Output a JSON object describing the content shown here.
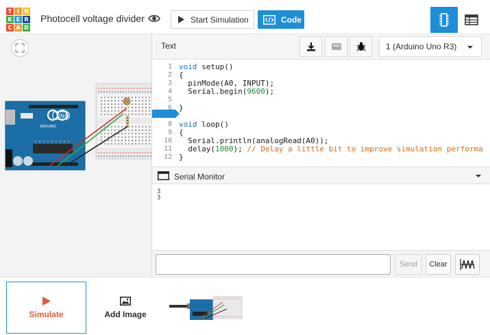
{
  "header": {
    "logo_letters": [
      "T",
      "I",
      "N",
      "K",
      "E",
      "R",
      "C",
      "A",
      "D"
    ],
    "logo_colors": [
      "#e84f3c",
      "#f29b2f",
      "#f6c31e",
      "#43b14b",
      "#2f9fd9",
      "#1a4e9a",
      "#e84f3c",
      "#f29b2f",
      "#43b14b"
    ],
    "project_title": "Photocell voltage divider",
    "start_simulation_label": "Start Simulation",
    "code_label": "Code"
  },
  "code_panel": {
    "mode": "Text",
    "device": "1 (Arduino Uno R3)",
    "lines": [
      {
        "n": "1",
        "text": "void setup()"
      },
      {
        "n": "2",
        "text": "{"
      },
      {
        "n": "3",
        "text": "  pinMode(A0, INPUT);"
      },
      {
        "n": "4",
        "text": "  Serial.begin(9600);"
      },
      {
        "n": "5",
        "text": ""
      },
      {
        "n": "6",
        "text": "}"
      },
      {
        "n": "7",
        "text": ""
      },
      {
        "n": "8",
        "text": "void loop()"
      },
      {
        "n": "9",
        "text": "{"
      },
      {
        "n": "10",
        "text": "  Serial.println(analogRead(A0));"
      },
      {
        "n": "11",
        "text": "  delay(1000); // Delay a little bit to improve simulation performa"
      },
      {
        "n": "12",
        "text": "}"
      }
    ],
    "active_line": "7"
  },
  "serial_monitor": {
    "title": "Serial Monitor",
    "output_lines": [
      "3",
      "3"
    ],
    "input_value": "",
    "send_label": "Send",
    "clear_label": "Clear"
  },
  "bottom": {
    "simulate_label": "Simulate",
    "add_image_label": "Add Image"
  },
  "board": {
    "brand_text": "UNO",
    "arduino_text": "ARDUINO"
  },
  "colors": {
    "accent": "#1e8ed6",
    "simulate": "#e35a3a",
    "board": "#1b6fa6"
  }
}
